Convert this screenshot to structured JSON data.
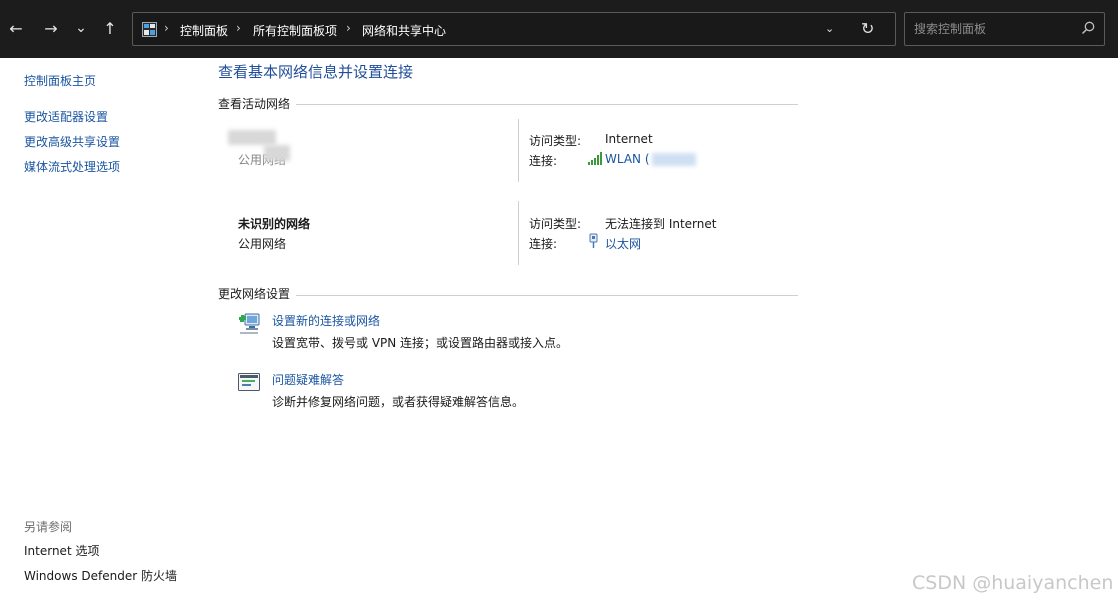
{
  "toolbar": {
    "back": "←",
    "forward": "→",
    "recent": "⌄",
    "up": "↑"
  },
  "address": {
    "crumbs": [
      "控制面板",
      "所有控制面板项",
      "网络和共享中心"
    ],
    "separator": "›",
    "dropdown": "⌄",
    "refresh": "↻"
  },
  "search": {
    "placeholder": "搜索控制面板"
  },
  "left_pane": {
    "links": [
      "控制面板主页",
      "更改适配器设置",
      "更改高级共享设置",
      "媒体流式处理选项"
    ],
    "see_also_title": "另请参阅",
    "see_also": [
      "Internet 选项",
      "Windows Defender 防火墙"
    ]
  },
  "main": {
    "title": "查看基本网络信息并设置连接",
    "active_networks_header": "查看活动网络",
    "networks": [
      {
        "name": "",
        "type": "公用网络",
        "access_type_label": "访问类型:",
        "access_type_value": "Internet",
        "connection_label": "连接:",
        "connection_value": "WLAN ("
      },
      {
        "name": "未识别的网络",
        "type": "公用网络",
        "access_type_label": "访问类型:",
        "access_type_value": "无法连接到 Internet",
        "connection_label": "连接:",
        "connection_value": "以太网"
      }
    ],
    "change_settings_header": "更改网络设置",
    "tasks": [
      {
        "link": "设置新的连接或网络",
        "desc": "设置宽带、拨号或 VPN 连接；或设置路由器或接入点。"
      },
      {
        "link": "问题疑难解答",
        "desc": "诊断并修复网络问题，或者获得疑难解答信息。"
      }
    ]
  },
  "watermark": "CSDN @huaiyanchen",
  "colors": {
    "link": "#1a55a0",
    "title": "#1f4e9c",
    "topbar": "#1c1c1c"
  }
}
